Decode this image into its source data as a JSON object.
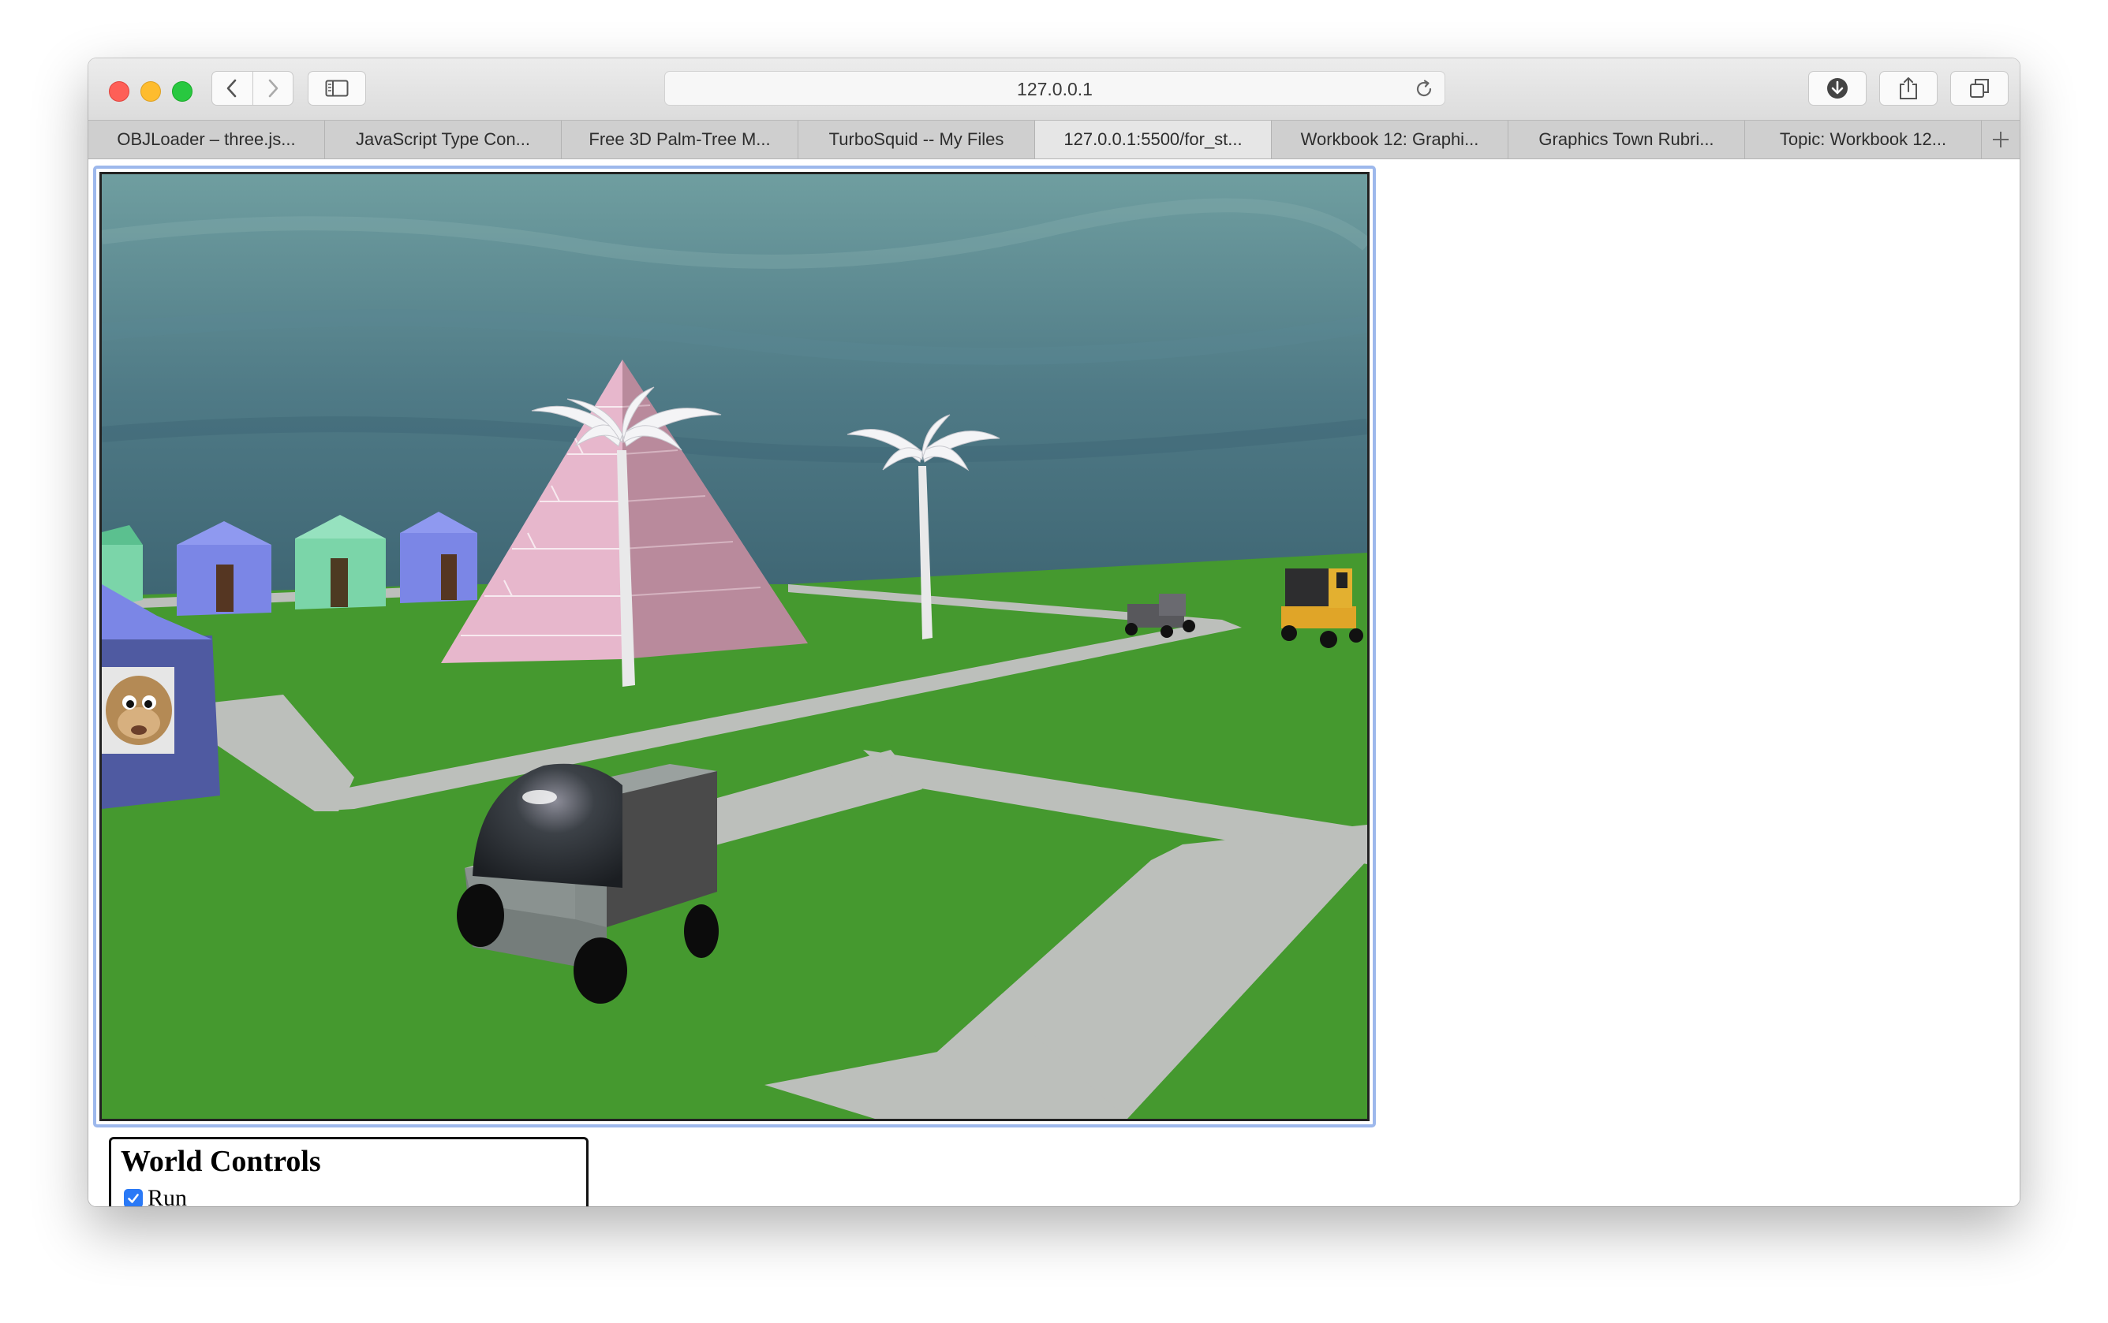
{
  "browser": {
    "url": "127.0.0.1",
    "icons": {
      "back": "chevron-left-icon",
      "forward": "chevron-right-icon",
      "sidebar": "sidebar-icon",
      "reload": "reload-icon",
      "downloads": "download-icon",
      "share": "share-icon",
      "tab_overview": "tab-overview-icon",
      "new_tab": "plus-icon"
    },
    "tabs": [
      {
        "label": "OBJLoader – three.js...",
        "active": false
      },
      {
        "label": "JavaScript Type Con...",
        "active": false
      },
      {
        "label": "Free 3D Palm-Tree M...",
        "active": false
      },
      {
        "label": "TurboSquid -- My Files",
        "active": false
      },
      {
        "label": "127.0.0.1:5500/for_st...",
        "active": true
      },
      {
        "label": "Workbook 12: Graphi...",
        "active": false
      },
      {
        "label": "Graphics Town Rubri...",
        "active": false
      },
      {
        "label": "Topic: Workbook 12...",
        "active": false
      }
    ]
  },
  "page": {
    "controls": {
      "title": "World Controls",
      "run_label": "Run",
      "run_checked": true
    }
  },
  "colors": {
    "grass": "#45992f",
    "road": "#bcbfbb",
    "sky": "#4f7a86",
    "pyramid": "#e7b7cc",
    "focus_ring": "#9db8ec",
    "checkbox": "#2a79f6"
  }
}
